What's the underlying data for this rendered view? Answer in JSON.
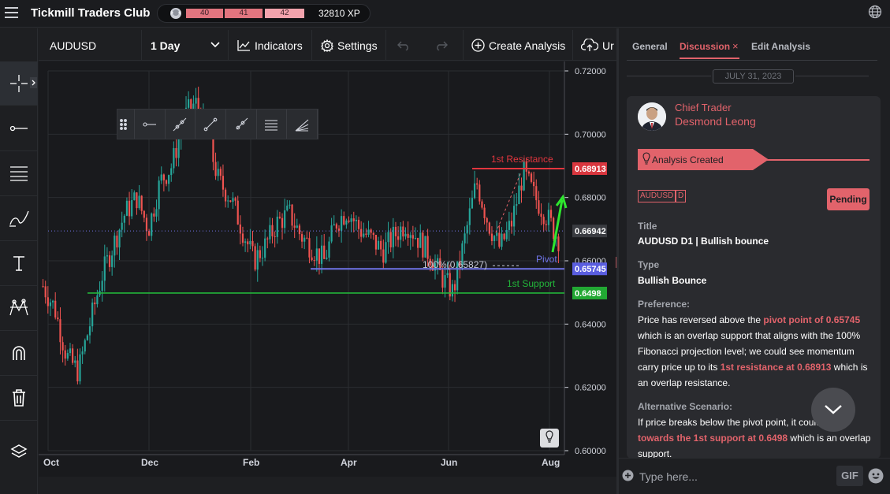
{
  "app": {
    "title": "Tickmill Traders Club"
  },
  "xp": {
    "levels": [
      "40",
      "41",
      "42"
    ],
    "value": "32810 XP"
  },
  "toolbar": {
    "symbol": "AUDUSD",
    "interval": "1 Day",
    "indicators": "Indicators",
    "settings": "Settings",
    "create_analysis": "Create Analysis",
    "upload": "Ur"
  },
  "tools": [
    "crosshair-icon",
    "horizontal-line-icon",
    "fib-lines-icon",
    "brush-icon",
    "text-icon",
    "pattern-icon",
    "magnet-icon",
    "trash-icon",
    "layers-icon"
  ],
  "drawing_toolbar": [
    "drag-handle-icon",
    "horizontal-ray-icon",
    "extended-line-icon",
    "trend-line-icon",
    "ray-icon",
    "parallel-channel-icon",
    "fib-fan-icon"
  ],
  "chart_data": {
    "type": "candlestick",
    "symbol": "AUDUSD",
    "timeframe": "D1",
    "y_ticks": [
      "0.72000",
      "0.70000",
      "0.68000",
      "0.66000",
      "0.64000",
      "0.62000",
      "0.60000"
    ],
    "ylim": [
      0.6,
      0.72
    ],
    "x_ticks": [
      "Oct",
      "Dec",
      "Feb",
      "Apr",
      "Jun",
      "Aug"
    ],
    "series_close_approx": [
      0.652,
      0.645,
      0.63,
      0.625,
      0.64,
      0.655,
      0.665,
      0.675,
      0.68,
      0.67,
      0.685,
      0.69,
      0.705,
      0.71,
      0.7,
      0.685,
      0.68,
      0.67,
      0.66,
      0.665,
      0.672,
      0.675,
      0.668,
      0.664,
      0.66,
      0.672,
      0.676,
      0.67,
      0.667,
      0.663,
      0.668,
      0.672,
      0.667,
      0.662,
      0.655,
      0.65,
      0.667,
      0.685,
      0.672,
      0.664,
      0.672,
      0.688,
      0.68,
      0.674,
      0.667
    ],
    "levels": [
      {
        "label": "1st Resistance",
        "value": "0.68913",
        "color": "#e2363e"
      },
      {
        "label": "Pivot",
        "value": "0.65745",
        "color": "#7074e8"
      },
      {
        "label": "1st Support",
        "value": "0.6498",
        "color": "#22b53a"
      }
    ],
    "current_price": "0.66942",
    "fib_label": "100%(0.65827)",
    "colors": {
      "up": "#26a69a",
      "down": "#ef5350",
      "grid": "#2b2d31"
    }
  },
  "panel": {
    "tabs": [
      "General",
      "Discussion",
      "Edit Analysis"
    ],
    "close": "×",
    "date": "JULY 31, 2023",
    "role": "Chief Trader",
    "author": "Desmond Leong",
    "created_badge": "Analysis Created",
    "tags": [
      "AUDUSD",
      "D"
    ],
    "status": "Pending",
    "title_label": "Title",
    "title_value": "AUDUSD D1 | Bullish bounce",
    "type_label": "Type",
    "type_value": "Bullish Bounce",
    "pref_label": "Preference:",
    "pref_1": "Price has reversed above the ",
    "pref_hl1": "pivot point of 0.65745",
    "pref_2": " which is an overlap support that aligns with the 100% Fibonacci projection level; we could see momentum carry price up to its ",
    "pref_hl2": "1st resistance at 0.68913",
    "pref_3": " which is an overlap resistance.",
    "alt_label": "Alternative Scenario:",
    "alt_1": "If price breaks below the pivot point, it could h",
    "alt_hl": "ead towards the 1st support at 0.6498",
    "alt_2": " which is an overlap support.",
    "composer_placeholder": "Type here...",
    "gif": "GIF"
  }
}
